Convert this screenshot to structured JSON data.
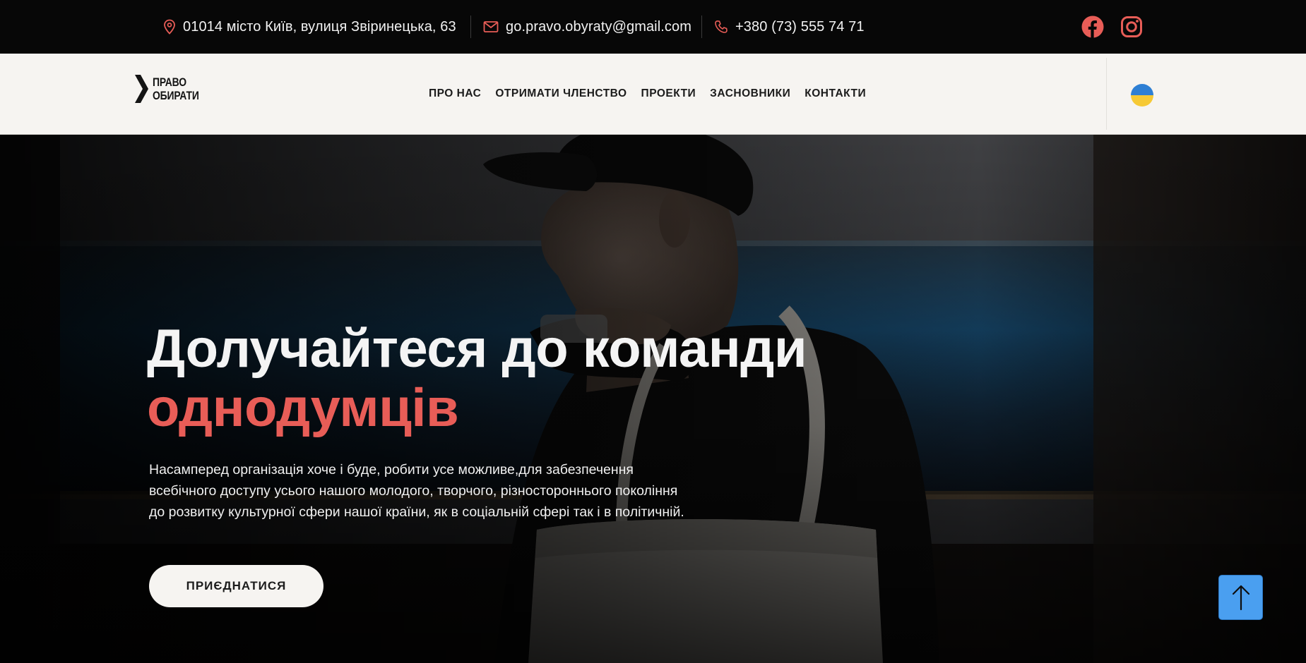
{
  "topbar": {
    "address": "01014 місто Київ, вулиця Звіринецька, 63",
    "email": "go.pravo.obyraty@gmail.com",
    "phone": "+380 (73) 555 74 71",
    "icons": {
      "address": "map-pin-icon",
      "email": "envelope-icon",
      "phone": "phone-icon",
      "social": [
        "facebook-icon",
        "instagram-icon"
      ]
    }
  },
  "logo": {
    "line1": "ПРАВО",
    "line2": "ОБИРАТИ"
  },
  "nav": {
    "items": [
      "ПРО НАС",
      "ОТРИМАТИ ЧЛЕНСТВО",
      "ПРОЕКТИ",
      "ЗАСНОВНИКИ",
      "КОНТАКТИ"
    ],
    "language_icon": "ukraine-flag-icon"
  },
  "hero": {
    "title_line1": "Долучайтеся до команди",
    "title_line2": "однодумців",
    "text_lines": [
      "Насамперед організація хоче і буде, робити усе можливе,для забезпечення",
      "всебічного доступу усього нашого молодого, творчого, різностороннього покоління",
      "до розвитку культурної сфери нашої країни, як в соціальній сфері так і в політичній."
    ],
    "button_label": "ПРИЄДНАТИСЯ"
  },
  "scroll_top_icon": "arrow-up-icon",
  "colors": {
    "accent": "#e85d57",
    "topbar_bg": "#070707",
    "nav_bg": "#f6f4f1",
    "scroll_button": "#4a9ff0",
    "flag_blue": "#2e7fd4",
    "flag_yellow": "#f6c935"
  }
}
